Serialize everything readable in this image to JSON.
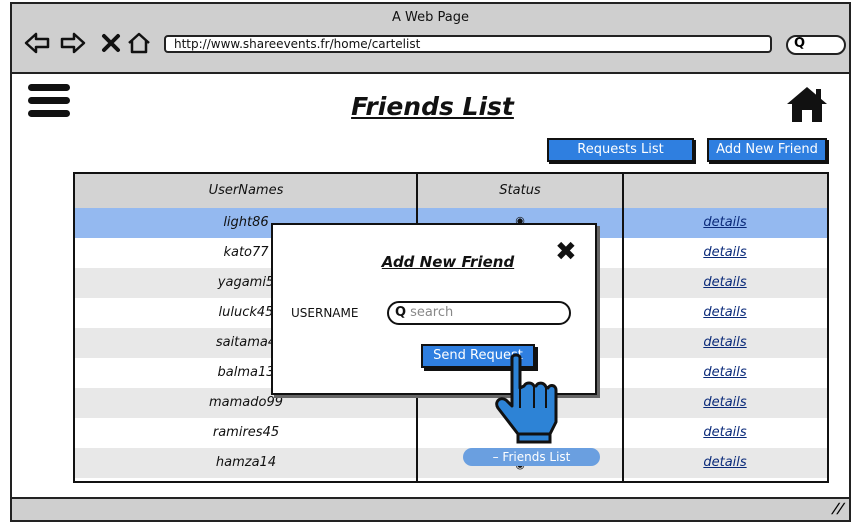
{
  "browser": {
    "window_title": "A Web Page",
    "url": "http://www.shareevents.fr/home/cartelist"
  },
  "page": {
    "title": "Friends List"
  },
  "toolbar": {
    "requests_label": "Requests List",
    "add_friend_label": "Add New Friend"
  },
  "table": {
    "headers": {
      "username": "UserNames",
      "status": "Status",
      "details": ""
    },
    "rows": [
      {
        "username": "light86",
        "details": "details"
      },
      {
        "username": "kato77",
        "details": "details"
      },
      {
        "username": "yagami5",
        "details": "details"
      },
      {
        "username": "luluck45",
        "details": "details"
      },
      {
        "username": "saitama4",
        "details": "details"
      },
      {
        "username": "balma13",
        "details": "details"
      },
      {
        "username": "mamado99",
        "details": "details"
      },
      {
        "username": "ramires45",
        "details": "details"
      },
      {
        "username": "hamza14",
        "details": "details"
      }
    ],
    "colors": {
      "selected_row": "#94b9f0",
      "alt_row": "#e8e8e8",
      "header": "#d3d3d3"
    }
  },
  "modal": {
    "title": "Add New Friend",
    "username_label": "USERNAME",
    "search_placeholder": "search",
    "send_label": "Send Request"
  },
  "tooltip": {
    "label": "– Friends List"
  },
  "colors": {
    "accent": "#2f7fe0",
    "chrome": "#cfcfcf"
  },
  "icons": [
    "back-arrow-icon",
    "forward-arrow-icon",
    "close-x-icon",
    "home-outline-icon",
    "search-icon",
    "hamburger-menu-icon",
    "home-icon",
    "close-icon",
    "pointing-hand-icon",
    "resize-grip-icon"
  ]
}
